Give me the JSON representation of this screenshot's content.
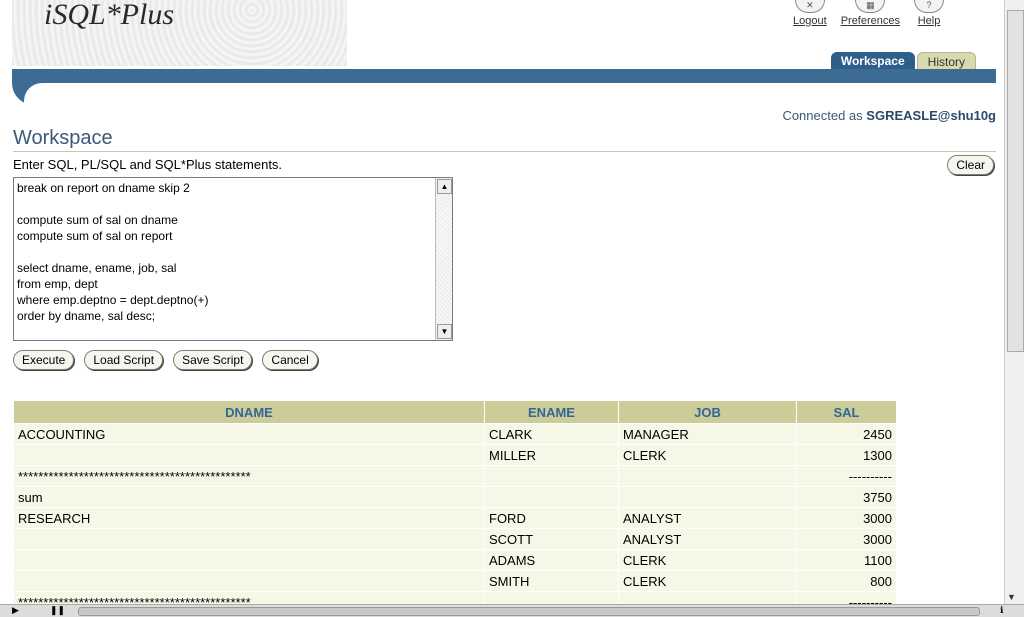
{
  "app": {
    "logo": "iSQL*Plus"
  },
  "toplinks": [
    {
      "label": "Logout",
      "icon": "logout-icon"
    },
    {
      "label": "Preferences",
      "icon": "preferences-icon"
    },
    {
      "label": "Help",
      "icon": "help-icon"
    }
  ],
  "tabs": {
    "workspace": "Workspace",
    "history": "History"
  },
  "connection": {
    "prefix": "Connected as",
    "user": "SGREASLE@shu10g"
  },
  "page": {
    "title": "Workspace",
    "prompt": "Enter SQL, PL/SQL and SQL*Plus statements."
  },
  "buttons": {
    "clear": "Clear",
    "execute": "Execute",
    "load": "Load Script",
    "save": "Save Script",
    "cancel": "Cancel"
  },
  "editor": {
    "text": "break on report on dname skip 2\n\ncompute sum of sal on dname\ncompute sum of sal on report\n\nselect dname, ename, job, sal\nfrom emp, dept\nwhere emp.deptno = dept.deptno(+)\norder by dname, sal desc;"
  },
  "results": {
    "headers": [
      "DNAME",
      "ENAME",
      "JOB",
      "SAL"
    ],
    "rows": [
      [
        "ACCOUNTING",
        "CLARK",
        "MANAGER",
        "2450"
      ],
      [
        "",
        "MILLER",
        "CLERK",
        "1300"
      ],
      [
        "**********************************************",
        "",
        "",
        "----------"
      ],
      [
        "sum",
        "",
        "",
        "3750"
      ],
      [
        "RESEARCH",
        "FORD",
        "ANALYST",
        "3000"
      ],
      [
        "",
        "SCOTT",
        "ANALYST",
        "3000"
      ],
      [
        "",
        "ADAMS",
        "CLERK",
        "1100"
      ],
      [
        "",
        "SMITH",
        "CLERK",
        "800"
      ],
      [
        "**********************************************",
        "",
        "",
        "----------"
      ]
    ]
  },
  "colors": {
    "header_bar": "#3c6c94",
    "table_header": "#cccc99",
    "table_cell": "#f7f7e7",
    "title": "#3a5a78"
  }
}
